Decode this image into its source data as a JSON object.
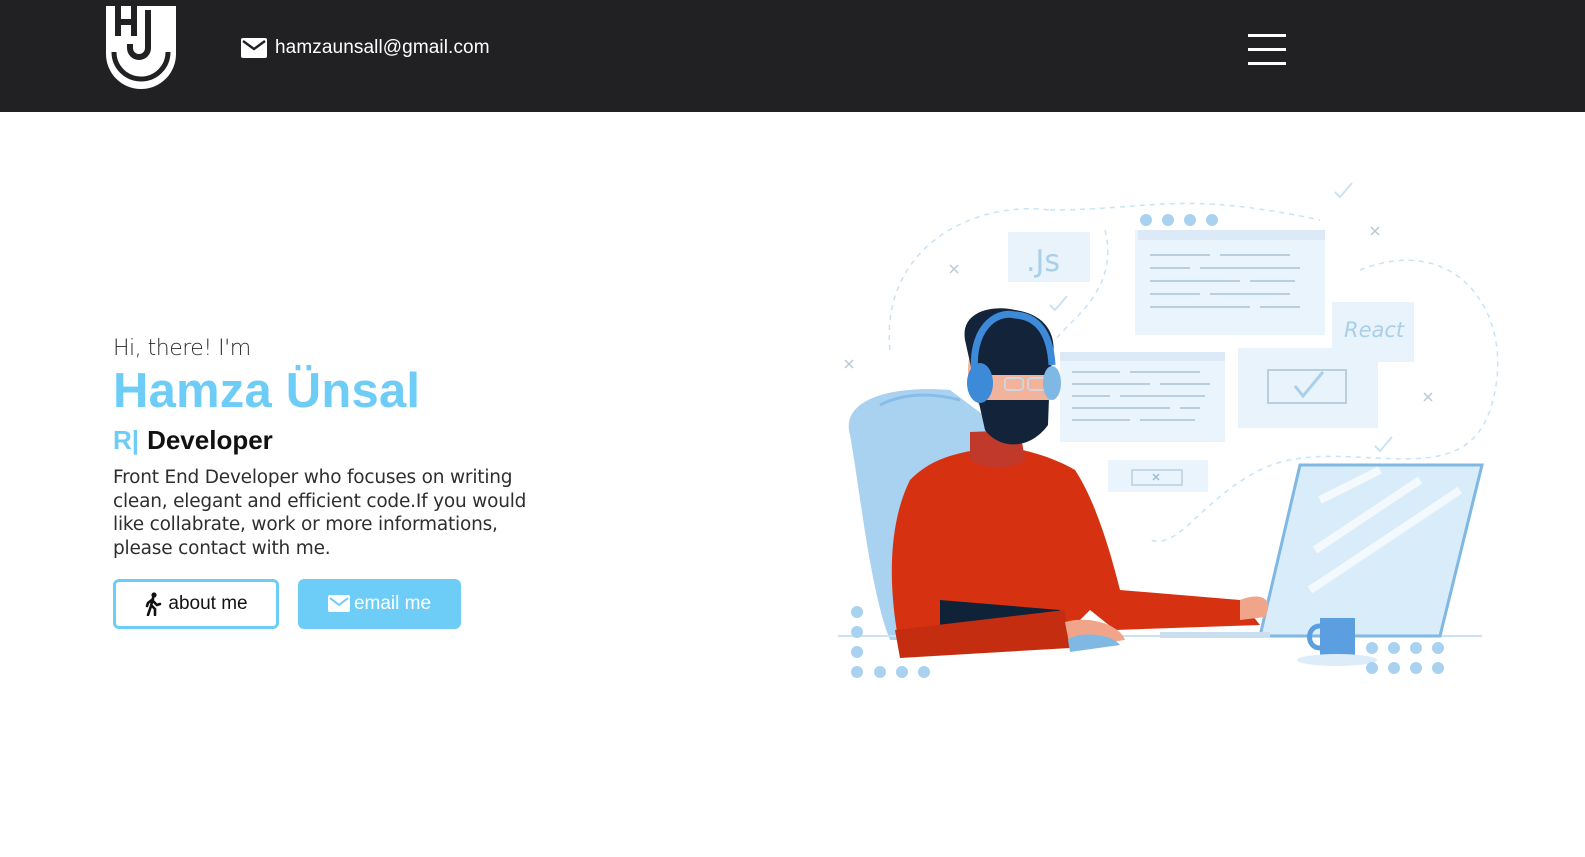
{
  "header": {
    "logo_icon": "hj-monogram-logo",
    "email": "hamzaunsall@gmail.com",
    "email_icon": "envelope-icon",
    "menu_icon": "hamburger-menu-icon"
  },
  "hero": {
    "greeting": "Hi, there! I'm",
    "name": "Hamza Ünsal",
    "typed_text": "R|",
    "role": "Developer",
    "description": "Front End Developer who focuses on writing clean, elegant and efficient code.If you would like collabrate, work or more informations, please contact with me."
  },
  "buttons": {
    "about_label": "about me",
    "about_icon": "person-walking-icon",
    "email_label": "email me",
    "email_icon": "envelope-icon"
  },
  "illustration": {
    "js_label": ".Js",
    "react_label": "React"
  },
  "colors": {
    "header_bg": "#212124",
    "accent": "#6ecdf7",
    "shirt": "#d63212"
  }
}
